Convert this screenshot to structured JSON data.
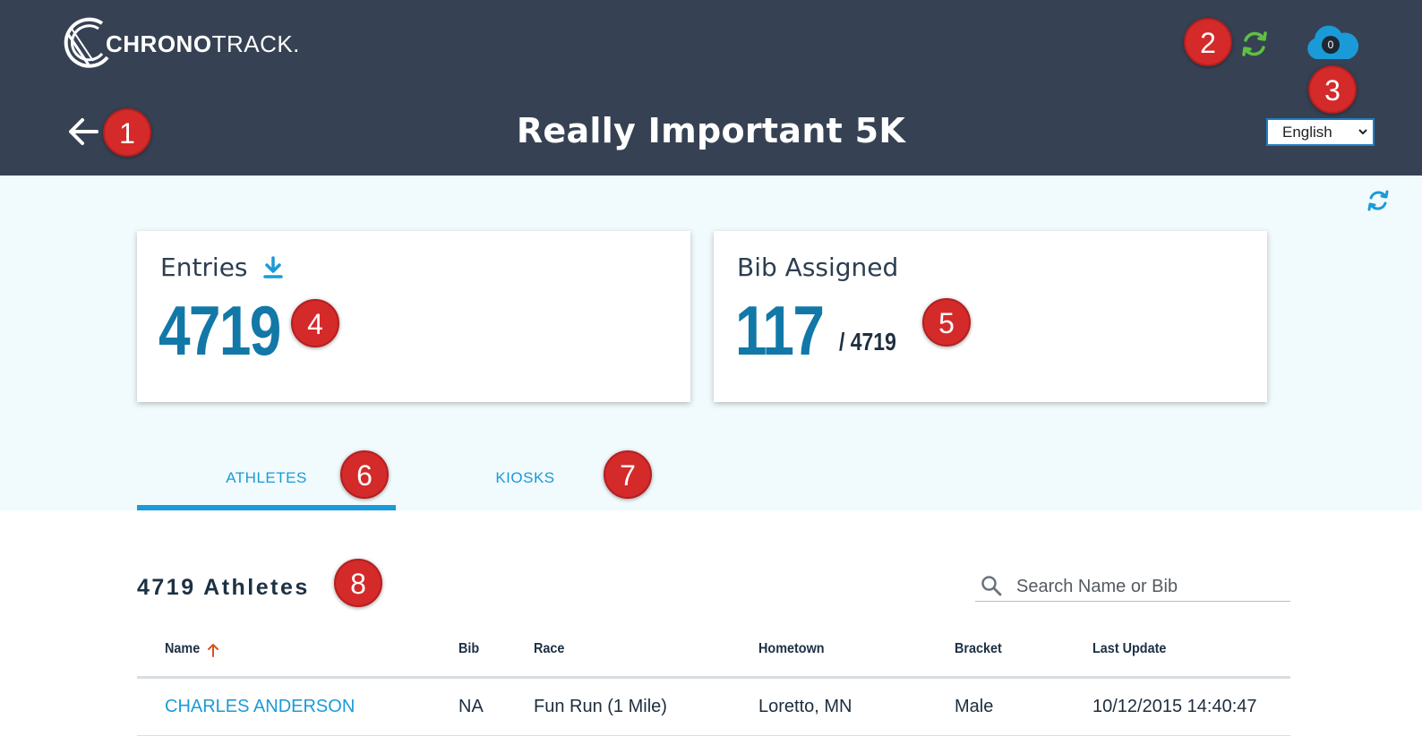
{
  "header": {
    "logo_bold": "CHRONO",
    "logo_light": "TRACK.",
    "title": "Really Important 5K",
    "cloud_count": "0",
    "language_selected": "English"
  },
  "cards": {
    "entries": {
      "label": "Entries",
      "value": "4719"
    },
    "bib": {
      "label": "Bib Assigned",
      "value": "117",
      "of_total": "/ 4719"
    }
  },
  "tabs": [
    {
      "label": "ATHLETES",
      "active": true
    },
    {
      "label": "KIOSKS",
      "active": false
    }
  ],
  "athletes": {
    "count_label": "4719 Athletes",
    "search_placeholder": "Search Name or Bib"
  },
  "table": {
    "columns": [
      "Name",
      "Bib",
      "Race",
      "Hometown",
      "Bracket",
      "Last Update"
    ],
    "rows": [
      {
        "name": "CHARLES ANDERSON",
        "bib": "NA",
        "race": "Fun Run (1 Mile)",
        "hometown": "Loretto, MN",
        "bracket": "Male",
        "last_update": "10/12/2015 14:40:47"
      }
    ]
  },
  "markers": [
    "1",
    "2",
    "3",
    "4",
    "5",
    "6",
    "7",
    "8"
  ],
  "colors": {
    "header_bg": "#364254",
    "accent_blue": "#1a9bd7",
    "number_blue": "#1278a7",
    "sync_green": "#5fc142",
    "marker_red": "#d42a2a",
    "dashboard_bg": "#f1fafd"
  }
}
